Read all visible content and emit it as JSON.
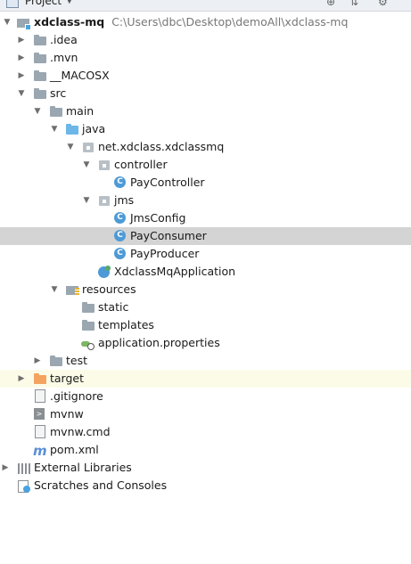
{
  "panel": {
    "title": "Project"
  },
  "tree": {
    "root": {
      "label": "xdclass-mq",
      "path": "C:\\Users\\dbc\\Desktop\\demoAll\\xdclass-mq"
    },
    "idea": ".idea",
    "mvn": ".mvn",
    "macosx": "__MACOSX",
    "src": "src",
    "main": "main",
    "java": "java",
    "package": "net.xdclass.xdclassmq",
    "controller": "controller",
    "pay_controller": "PayController",
    "jms": "jms",
    "jms_config": "JmsConfig",
    "pay_consumer": "PayConsumer",
    "pay_producer": "PayProducer",
    "application_class": "XdclassMqApplication",
    "resources": "resources",
    "static": "static",
    "templates": "templates",
    "application_properties": "application.properties",
    "test": "test",
    "target": "target",
    "gitignore": ".gitignore",
    "mvnw": "mvnw",
    "mvnw_cmd": "mvnw.cmd",
    "pom": "pom.xml",
    "external_libraries": "External Libraries",
    "scratches": "Scratches and Consoles"
  },
  "icons": {
    "class_glyph": "C",
    "pom_glyph": "m",
    "text_glyph": ">"
  },
  "colors": {
    "selected_row": "#d4d4d4",
    "excluded_row": "#fbfbe8",
    "folder": "#9aa7b0",
    "source_folder": "#6cb6e8",
    "target_folder": "#f4a460",
    "class_icon": "#4d9ad6"
  }
}
